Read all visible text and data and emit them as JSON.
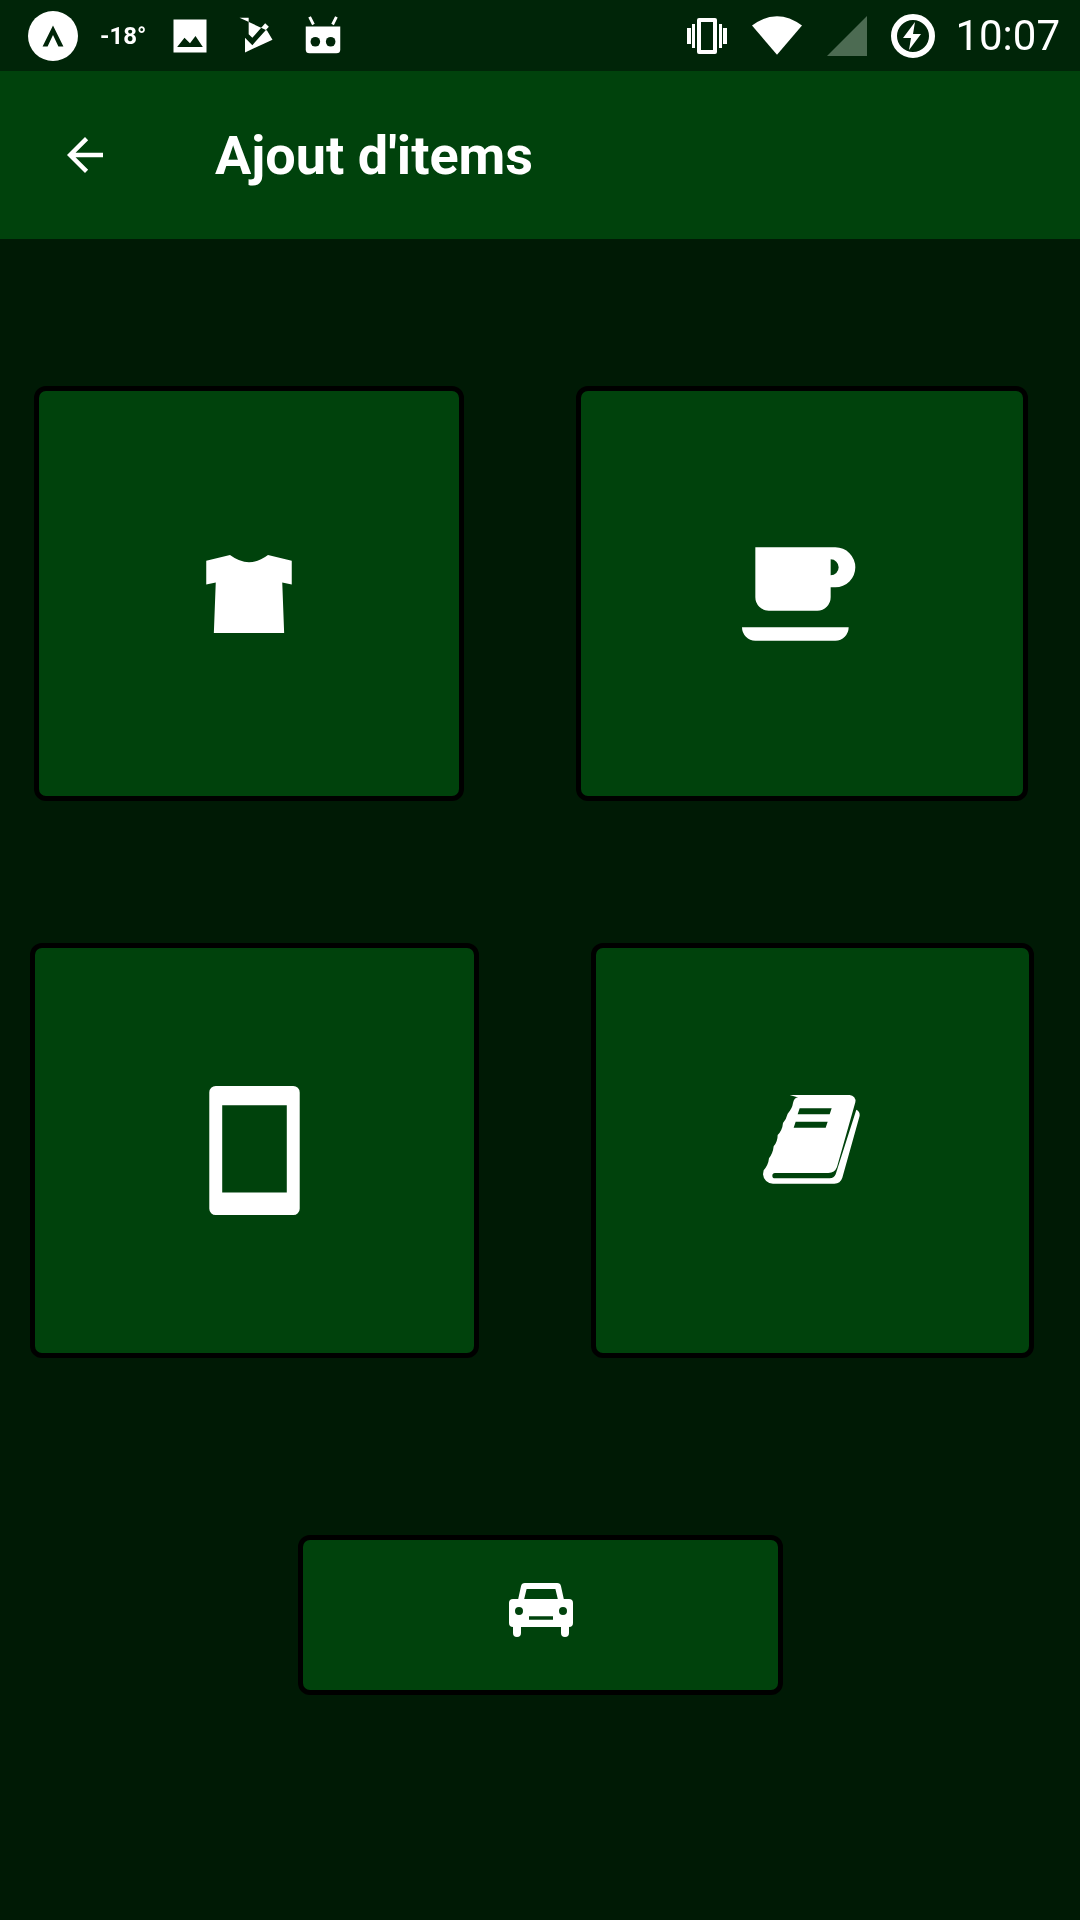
{
  "status_bar": {
    "temperature": "-18°",
    "time": "10:07"
  },
  "app_bar": {
    "title": "Ajout d'items"
  },
  "tiles": [
    {
      "kind": "shirt"
    },
    {
      "kind": "cup"
    },
    {
      "kind": "phone"
    },
    {
      "kind": "book"
    },
    {
      "kind": "car"
    }
  ]
}
